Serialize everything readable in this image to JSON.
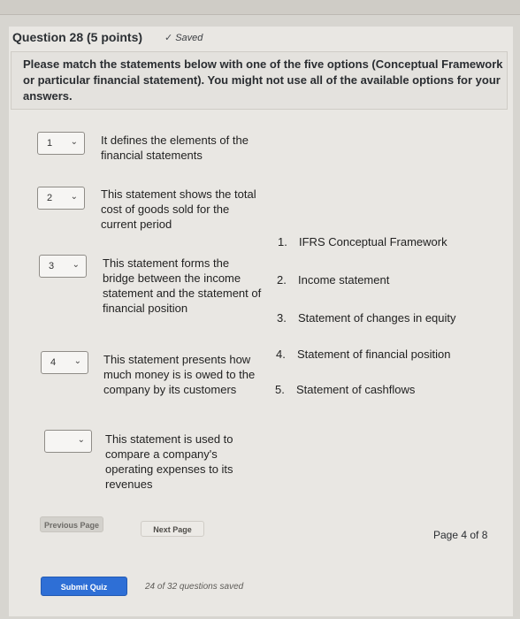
{
  "question": {
    "title": "Question 28 (5 points)",
    "saved": "Saved",
    "saved_icon": "checkmark-icon",
    "instructions": "Please match the statements below with one of the five options (Conceptual Framework or particular financial statement). You might not use all of the available options for your answers."
  },
  "matches": [
    {
      "selected": "1",
      "statement": "It defines the elements of the financial statements"
    },
    {
      "selected": "2",
      "statement": "This statement shows the total cost of goods sold for the current period"
    },
    {
      "selected": "3",
      "statement": "This statement forms the bridge between the income statement and the statement of financial position"
    },
    {
      "selected": "4",
      "statement": "This statement presents how much money is is owed to the company by its customers"
    },
    {
      "selected": "",
      "statement": "This statement is used to compare a company's operating expenses to its revenues"
    }
  ],
  "options": [
    {
      "num": "1.",
      "label": "IFRS Conceptual Framework"
    },
    {
      "num": "2.",
      "label": "Income statement"
    },
    {
      "num": "3.",
      "label": "Statement of changes in equity"
    },
    {
      "num": "4.",
      "label": "Statement of financial position"
    },
    {
      "num": "5.",
      "label": "Statement of cashflows"
    }
  ],
  "nav": {
    "previous": "Previous Page",
    "next": "Next Page",
    "page": "Page 4 of 8",
    "submit": "Submit Quiz",
    "saved_count": "24 of 32 questions saved"
  }
}
